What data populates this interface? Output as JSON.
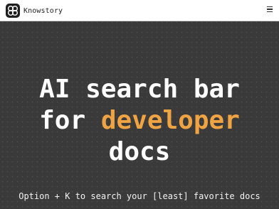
{
  "navbar": {
    "brand_name": "Knowstory",
    "logo_icon": "knot-logo-icon",
    "menu_icon": "hamburger-menu-icon"
  },
  "hero": {
    "headline_line1": "AI search bar",
    "headline_line2_prefix": "for ",
    "headline_line2_accent": "developer",
    "headline_line3": "docs",
    "subheadline": "Option + K to search your [least] favorite docs"
  },
  "colors": {
    "background": "#3a3a3a",
    "accent": "#f0a343",
    "navbar_bg": "#ffffff",
    "text_light": "#ffffff"
  }
}
